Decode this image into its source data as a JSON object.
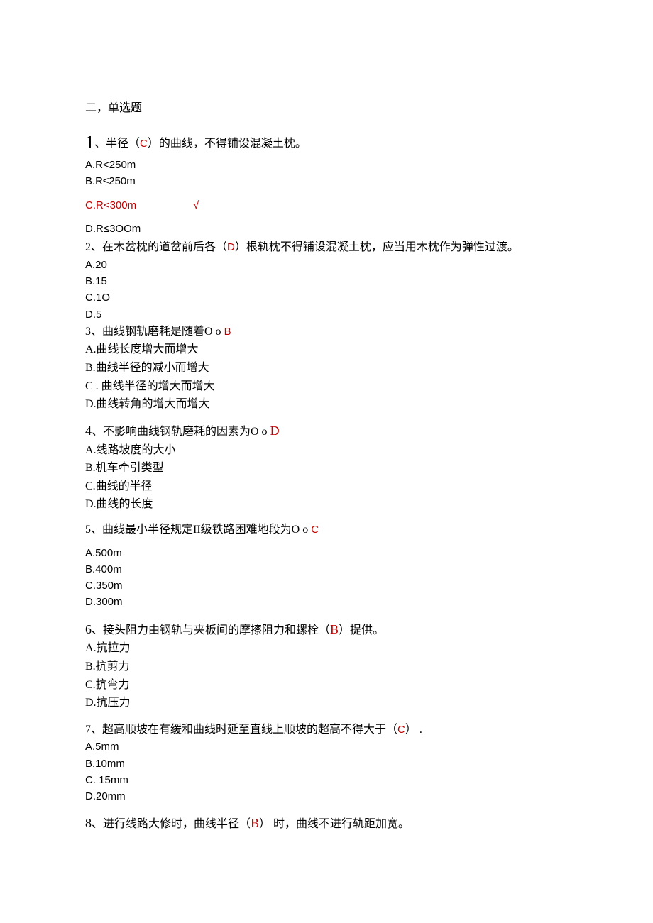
{
  "header": "二，单选题",
  "q1": {
    "num": "1",
    "pre": "、半径（",
    "ans_letter": "C",
    "post": "）的曲线，不得铺设混凝土枕。",
    "a": "A.R<250m",
    "b": "B.R≤250m",
    "c": "C.R<300m",
    "check": "√",
    "d": "D.R≤3OOm"
  },
  "q2": {
    "stem_pre": "2、在木岔枕的道岔前后各（",
    "ans_letter": "D",
    "stem_post": "）根轨枕不得铺设混凝土枕，应当用木枕作为弹性过渡。",
    "a": "A.20",
    "b": "B.15",
    "c": "C.1O",
    "d": "D.5"
  },
  "q3": {
    "stem": "3、曲线钢轨磨耗是随着O o ",
    "ans_letter": "B",
    "a": "A.曲线长度增大而增大",
    "b": "B.曲线半径的减小而增大",
    "c": "C . 曲线半径的增大而增大",
    "d": "D.曲线转角的增大而增大"
  },
  "q4": {
    "num": "4",
    "stem": "、不影响曲线钢轨磨耗的因素为O o ",
    "ans_letter": "D",
    "a": "A.线路坡度的大小",
    "b": "B.机车牵引类型",
    "c": "C.曲线的半径",
    "d": "D.曲线的长度"
  },
  "q5": {
    "stem": "5、曲线最小半径规定II级铁路困难地段为O o ",
    "ans_letter": "C",
    "a": "A.500m",
    "b": "B.400m",
    "c": "C.350m",
    "d": "D.300m"
  },
  "q6": {
    "num": "6",
    "pre": "、接头阻力由钢轨与夹板间的摩擦阻力和螺栓（",
    "ans_letter": "B",
    "post": "）提供。",
    "a": "A.抗拉力",
    "b": "B.抗剪力",
    "c": "C.抗弯力",
    "d": "D.抗压力"
  },
  "q7": {
    "pre": "7、超高顺坡在有缓和曲线时延至直线上顺坡的超高不得大于（",
    "ans_letter": "C",
    "post": "） .",
    "a": "A.5mm",
    "b": "B.10mm",
    "c": "C. 15mm",
    "d": "D.20mm"
  },
  "q8": {
    "num": "8",
    "pre": "、进行线路大修时，曲线半径（",
    "ans_letter": "B",
    "post": "） 时，曲线不进行轨距加宽。"
  }
}
